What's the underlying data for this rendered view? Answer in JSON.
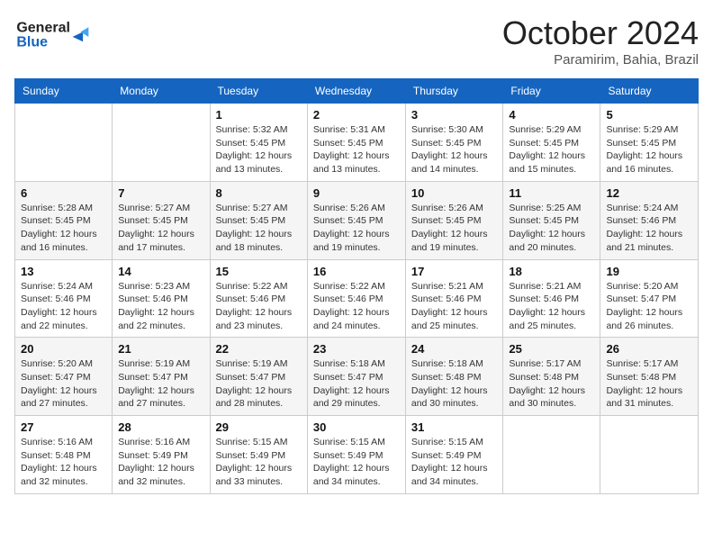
{
  "logo": {
    "line1": "General",
    "line2": "Blue"
  },
  "header": {
    "month": "October 2024",
    "location": "Paramirim, Bahia, Brazil"
  },
  "weekdays": [
    "Sunday",
    "Monday",
    "Tuesday",
    "Wednesday",
    "Thursday",
    "Friday",
    "Saturday"
  ],
  "weeks": [
    [
      {
        "day": "",
        "sunrise": "",
        "sunset": "",
        "daylight": ""
      },
      {
        "day": "",
        "sunrise": "",
        "sunset": "",
        "daylight": ""
      },
      {
        "day": "1",
        "sunrise": "Sunrise: 5:32 AM",
        "sunset": "Sunset: 5:45 PM",
        "daylight": "Daylight: 12 hours and 13 minutes."
      },
      {
        "day": "2",
        "sunrise": "Sunrise: 5:31 AM",
        "sunset": "Sunset: 5:45 PM",
        "daylight": "Daylight: 12 hours and 13 minutes."
      },
      {
        "day": "3",
        "sunrise": "Sunrise: 5:30 AM",
        "sunset": "Sunset: 5:45 PM",
        "daylight": "Daylight: 12 hours and 14 minutes."
      },
      {
        "day": "4",
        "sunrise": "Sunrise: 5:29 AM",
        "sunset": "Sunset: 5:45 PM",
        "daylight": "Daylight: 12 hours and 15 minutes."
      },
      {
        "day": "5",
        "sunrise": "Sunrise: 5:29 AM",
        "sunset": "Sunset: 5:45 PM",
        "daylight": "Daylight: 12 hours and 16 minutes."
      }
    ],
    [
      {
        "day": "6",
        "sunrise": "Sunrise: 5:28 AM",
        "sunset": "Sunset: 5:45 PM",
        "daylight": "Daylight: 12 hours and 16 minutes."
      },
      {
        "day": "7",
        "sunrise": "Sunrise: 5:27 AM",
        "sunset": "Sunset: 5:45 PM",
        "daylight": "Daylight: 12 hours and 17 minutes."
      },
      {
        "day": "8",
        "sunrise": "Sunrise: 5:27 AM",
        "sunset": "Sunset: 5:45 PM",
        "daylight": "Daylight: 12 hours and 18 minutes."
      },
      {
        "day": "9",
        "sunrise": "Sunrise: 5:26 AM",
        "sunset": "Sunset: 5:45 PM",
        "daylight": "Daylight: 12 hours and 19 minutes."
      },
      {
        "day": "10",
        "sunrise": "Sunrise: 5:26 AM",
        "sunset": "Sunset: 5:45 PM",
        "daylight": "Daylight: 12 hours and 19 minutes."
      },
      {
        "day": "11",
        "sunrise": "Sunrise: 5:25 AM",
        "sunset": "Sunset: 5:45 PM",
        "daylight": "Daylight: 12 hours and 20 minutes."
      },
      {
        "day": "12",
        "sunrise": "Sunrise: 5:24 AM",
        "sunset": "Sunset: 5:46 PM",
        "daylight": "Daylight: 12 hours and 21 minutes."
      }
    ],
    [
      {
        "day": "13",
        "sunrise": "Sunrise: 5:24 AM",
        "sunset": "Sunset: 5:46 PM",
        "daylight": "Daylight: 12 hours and 22 minutes."
      },
      {
        "day": "14",
        "sunrise": "Sunrise: 5:23 AM",
        "sunset": "Sunset: 5:46 PM",
        "daylight": "Daylight: 12 hours and 22 minutes."
      },
      {
        "day": "15",
        "sunrise": "Sunrise: 5:22 AM",
        "sunset": "Sunset: 5:46 PM",
        "daylight": "Daylight: 12 hours and 23 minutes."
      },
      {
        "day": "16",
        "sunrise": "Sunrise: 5:22 AM",
        "sunset": "Sunset: 5:46 PM",
        "daylight": "Daylight: 12 hours and 24 minutes."
      },
      {
        "day": "17",
        "sunrise": "Sunrise: 5:21 AM",
        "sunset": "Sunset: 5:46 PM",
        "daylight": "Daylight: 12 hours and 25 minutes."
      },
      {
        "day": "18",
        "sunrise": "Sunrise: 5:21 AM",
        "sunset": "Sunset: 5:46 PM",
        "daylight": "Daylight: 12 hours and 25 minutes."
      },
      {
        "day": "19",
        "sunrise": "Sunrise: 5:20 AM",
        "sunset": "Sunset: 5:47 PM",
        "daylight": "Daylight: 12 hours and 26 minutes."
      }
    ],
    [
      {
        "day": "20",
        "sunrise": "Sunrise: 5:20 AM",
        "sunset": "Sunset: 5:47 PM",
        "daylight": "Daylight: 12 hours and 27 minutes."
      },
      {
        "day": "21",
        "sunrise": "Sunrise: 5:19 AM",
        "sunset": "Sunset: 5:47 PM",
        "daylight": "Daylight: 12 hours and 27 minutes."
      },
      {
        "day": "22",
        "sunrise": "Sunrise: 5:19 AM",
        "sunset": "Sunset: 5:47 PM",
        "daylight": "Daylight: 12 hours and 28 minutes."
      },
      {
        "day": "23",
        "sunrise": "Sunrise: 5:18 AM",
        "sunset": "Sunset: 5:47 PM",
        "daylight": "Daylight: 12 hours and 29 minutes."
      },
      {
        "day": "24",
        "sunrise": "Sunrise: 5:18 AM",
        "sunset": "Sunset: 5:48 PM",
        "daylight": "Daylight: 12 hours and 30 minutes."
      },
      {
        "day": "25",
        "sunrise": "Sunrise: 5:17 AM",
        "sunset": "Sunset: 5:48 PM",
        "daylight": "Daylight: 12 hours and 30 minutes."
      },
      {
        "day": "26",
        "sunrise": "Sunrise: 5:17 AM",
        "sunset": "Sunset: 5:48 PM",
        "daylight": "Daylight: 12 hours and 31 minutes."
      }
    ],
    [
      {
        "day": "27",
        "sunrise": "Sunrise: 5:16 AM",
        "sunset": "Sunset: 5:48 PM",
        "daylight": "Daylight: 12 hours and 32 minutes."
      },
      {
        "day": "28",
        "sunrise": "Sunrise: 5:16 AM",
        "sunset": "Sunset: 5:49 PM",
        "daylight": "Daylight: 12 hours and 32 minutes."
      },
      {
        "day": "29",
        "sunrise": "Sunrise: 5:15 AM",
        "sunset": "Sunset: 5:49 PM",
        "daylight": "Daylight: 12 hours and 33 minutes."
      },
      {
        "day": "30",
        "sunrise": "Sunrise: 5:15 AM",
        "sunset": "Sunset: 5:49 PM",
        "daylight": "Daylight: 12 hours and 34 minutes."
      },
      {
        "day": "31",
        "sunrise": "Sunrise: 5:15 AM",
        "sunset": "Sunset: 5:49 PM",
        "daylight": "Daylight: 12 hours and 34 minutes."
      },
      {
        "day": "",
        "sunrise": "",
        "sunset": "",
        "daylight": ""
      },
      {
        "day": "",
        "sunrise": "",
        "sunset": "",
        "daylight": ""
      }
    ]
  ]
}
